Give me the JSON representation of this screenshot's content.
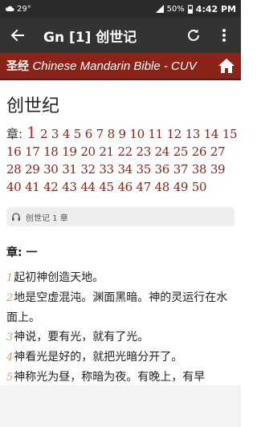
{
  "status_bar": {
    "temperature": "29°",
    "battery": "50%",
    "time": "4:42 PM"
  },
  "app_bar": {
    "title": "Gn [1] 创世记",
    "back_icon": "back-arrow-icon",
    "refresh_icon": "refresh-icon",
    "overflow_icon": "more-vert-icon"
  },
  "banner": {
    "cn_label": "圣经",
    "en_label": "Chinese Mandarin Bible - CUV",
    "home_icon": "home-icon",
    "color": "#8b2418"
  },
  "book": {
    "title": "创世纪"
  },
  "chapters": {
    "label": "章:",
    "current": "1",
    "list": [
      "2",
      "3",
      "4",
      "5",
      "6",
      "7",
      "8",
      "9",
      "10",
      "11",
      "12",
      "13",
      "14",
      "15",
      "16",
      "17",
      "18",
      "19",
      "20",
      "21",
      "22",
      "23",
      "24",
      "25",
      "26",
      "27",
      "28",
      "29",
      "30",
      "31",
      "32",
      "33",
      "34",
      "35",
      "36",
      "37",
      "38",
      "39",
      "40",
      "41",
      "42",
      "43",
      "44",
      "45",
      "46",
      "47",
      "48",
      "49",
      "50"
    ]
  },
  "audio": {
    "label": "创世记 1 章",
    "icon": "headphones-icon"
  },
  "chapter_heading": "章: 一",
  "verses": [
    {
      "num": "1",
      "text": "起初神创造天地。"
    },
    {
      "num": "2",
      "text": "地是空虚混沌。渊面黑暗。神的灵运行在水面上。"
    },
    {
      "num": "3",
      "text": "神说，要有光，就有了光。"
    },
    {
      "num": "4",
      "text": "神看光是好的，就把光暗分开了。"
    },
    {
      "num": "5",
      "text": "神称光为昼，称暗为夜。有晚上，有早"
    }
  ]
}
